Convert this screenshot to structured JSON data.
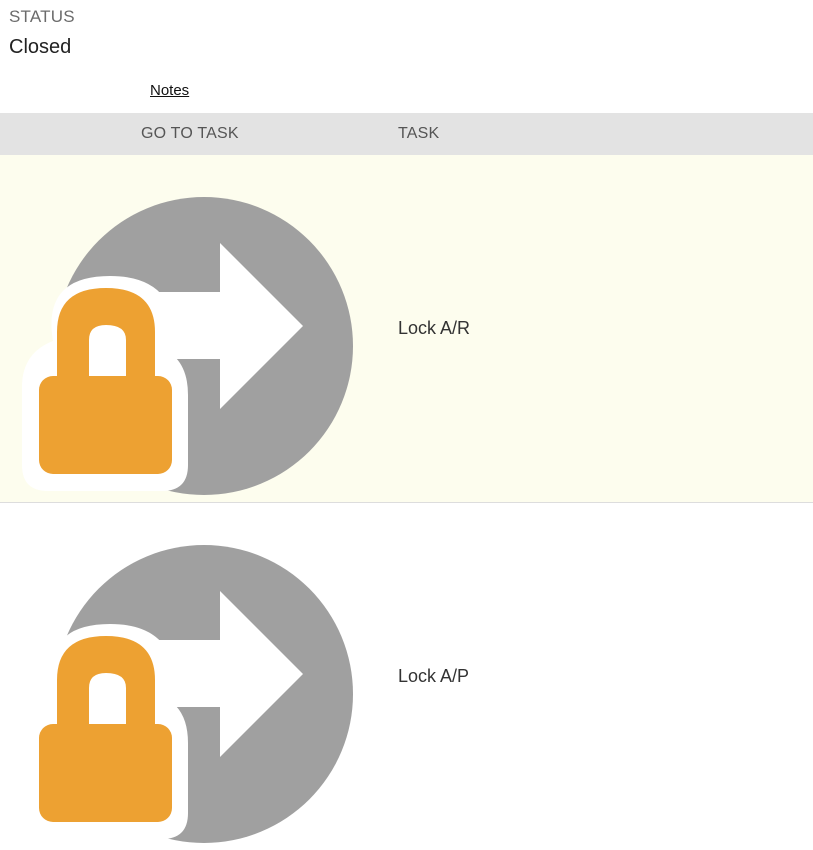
{
  "status": {
    "label": "STATUS",
    "value": "Closed"
  },
  "notes_link": "Notes",
  "table": {
    "columns": [
      "GO TO TASK",
      "TASK"
    ],
    "rows": [
      {
        "task": "Lock A/R",
        "icon": "goto-task-lock-icon",
        "highlighted": true
      },
      {
        "task": "Lock A/P",
        "icon": "goto-task-lock-icon",
        "highlighted": false
      }
    ]
  },
  "colors": {
    "header_bg": "#e3e3e3",
    "highlight_row_bg": "#fdfdee",
    "arrow_circle": "#a0a0a0",
    "lock": "#eda132"
  }
}
